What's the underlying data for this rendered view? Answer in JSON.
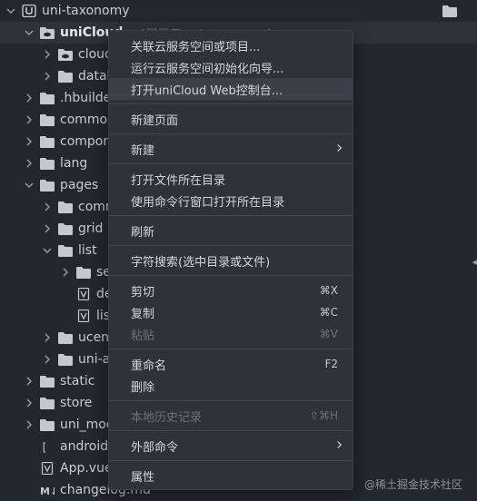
{
  "tree": {
    "rows": [
      {
        "label": "uni-taxonomy",
        "icon": "project-icon",
        "chev": "down",
        "indent": 0,
        "bold": false
      },
      {
        "label": "uniCloud",
        "meta": "[阿里云:uni-taxonomy]",
        "icon": "cloud-folder-icon",
        "chev": "down",
        "indent": 1,
        "bold": true,
        "selected": true
      },
      {
        "label": "cloudfunctions",
        "icon": "cloud-folder-icon",
        "chev": "right",
        "indent": 2
      },
      {
        "label": "database",
        "icon": "folder-icon",
        "chev": "right",
        "indent": 2
      },
      {
        "label": ".hbuilderx",
        "icon": "folder-icon",
        "chev": "right",
        "indent": 1
      },
      {
        "label": "common",
        "icon": "folder-icon",
        "chev": "right",
        "indent": 1
      },
      {
        "label": "components",
        "icon": "folder-icon",
        "chev": "right",
        "indent": 1
      },
      {
        "label": "lang",
        "icon": "folder-icon",
        "chev": "right",
        "indent": 1
      },
      {
        "label": "pages",
        "icon": "folder-icon",
        "chev": "down",
        "indent": 1
      },
      {
        "label": "common",
        "icon": "folder-icon",
        "chev": "right",
        "indent": 2
      },
      {
        "label": "grid",
        "icon": "folder-icon",
        "chev": "right",
        "indent": 2
      },
      {
        "label": "list",
        "icon": "folder-icon",
        "chev": "down",
        "indent": 2
      },
      {
        "label": "search",
        "icon": "folder-icon",
        "chev": "right",
        "indent": 3
      },
      {
        "label": "detail.vue",
        "icon": "vue-file-icon",
        "chev": "",
        "indent": 3
      },
      {
        "label": "list.vue",
        "icon": "vue-file-icon",
        "chev": "",
        "indent": 3
      },
      {
        "label": "ucenter",
        "icon": "folder-icon",
        "chev": "right",
        "indent": 2
      },
      {
        "label": "uni-agree",
        "icon": "folder-icon",
        "chev": "right",
        "indent": 2
      },
      {
        "label": "static",
        "icon": "folder-icon",
        "chev": "right",
        "indent": 1
      },
      {
        "label": "store",
        "icon": "folder-icon",
        "chev": "right",
        "indent": 1
      },
      {
        "label": "uni_modules",
        "icon": "folder-icon",
        "chev": "right",
        "indent": 1
      },
      {
        "label": "androidPrivacy.json",
        "icon": "json-file-icon",
        "chev": "",
        "indent": 1
      },
      {
        "label": "App.vue",
        "icon": "vue-file-icon",
        "chev": "",
        "indent": 1
      },
      {
        "label": "changelog.md",
        "icon": "md-file-icon",
        "chev": "",
        "indent": 1
      }
    ]
  },
  "menu": {
    "items": [
      {
        "label": "关联云服务空间或项目...",
        "name": "menu-link-cloud-space"
      },
      {
        "label": "运行云服务空间初始化向导...",
        "name": "menu-init-wizard"
      },
      {
        "label": "打开uniCloud Web控制台...",
        "name": "menu-open-web-console",
        "highlight": true
      },
      {
        "sep": true
      },
      {
        "label": "新建页面",
        "name": "menu-new-page"
      },
      {
        "sep": true
      },
      {
        "label": "新建",
        "name": "menu-new",
        "submenu": true
      },
      {
        "sep": true
      },
      {
        "label": "打开文件所在目录",
        "name": "menu-open-containing-folder"
      },
      {
        "label": "使用命令行窗口打开所在目录",
        "name": "menu-open-in-terminal"
      },
      {
        "sep": true
      },
      {
        "label": "刷新",
        "name": "menu-refresh"
      },
      {
        "sep": true
      },
      {
        "label": "字符搜索(选中目录或文件)",
        "name": "menu-search-text"
      },
      {
        "sep": true
      },
      {
        "label": "剪切",
        "shortcut": "⌘X",
        "name": "menu-cut"
      },
      {
        "label": "复制",
        "shortcut": "⌘C",
        "name": "menu-copy"
      },
      {
        "label": "粘贴",
        "shortcut": "⌘V",
        "name": "menu-paste",
        "disabled": true
      },
      {
        "sep": true
      },
      {
        "label": "重命名",
        "shortcut": "F2",
        "name": "menu-rename"
      },
      {
        "label": "删除",
        "name": "menu-delete"
      },
      {
        "sep": true
      },
      {
        "label": "本地历史记录",
        "shortcut": "⇧⌘H",
        "name": "menu-local-history",
        "disabled": true
      },
      {
        "sep": true
      },
      {
        "label": "外部命令",
        "name": "menu-external-commands",
        "submenu": true
      },
      {
        "sep": true
      },
      {
        "label": "属性",
        "name": "menu-properties"
      }
    ]
  },
  "watermark": "@稀土掘金技术社区",
  "colors": {
    "folder": "#c5c8ce",
    "background": "#23272e",
    "menu": "#2e3239"
  }
}
